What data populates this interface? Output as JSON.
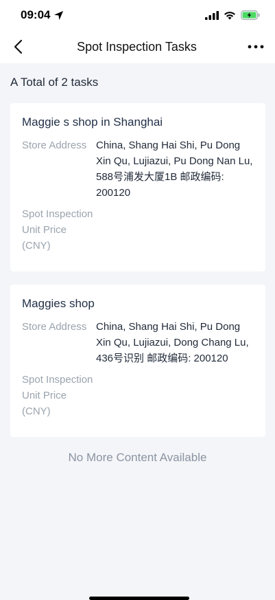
{
  "status_bar": {
    "time": "09:04"
  },
  "nav": {
    "title": "Spot Inspection Tasks"
  },
  "summary": "A Total of 2 tasks",
  "tasks": [
    {
      "shop_name": "Maggie s shop in Shanghai",
      "address_label": "Store Address",
      "address_value": "China, Shang Hai Shi, Pu Dong Xin Qu, Lujiazui, Pu Dong Nan Lu, 588号浦发大厦1B 邮政编码: 200120",
      "price_label": "Spot Inspection Unit Price (CNY)",
      "price_value": ""
    },
    {
      "shop_name": "Maggies shop",
      "address_label": "Store Address",
      "address_value": "China, Shang Hai Shi, Pu Dong Xin Qu, Lujiazui, Dong Chang Lu, 436号识别 邮政编码: 200120",
      "price_label": "Spot Inspection Unit Price (CNY)",
      "price_value": ""
    }
  ],
  "footer": {
    "no_more": "No More Content Available"
  },
  "colors": {
    "accent_battery": "#4cd964",
    "background": "#f4f5f8"
  }
}
